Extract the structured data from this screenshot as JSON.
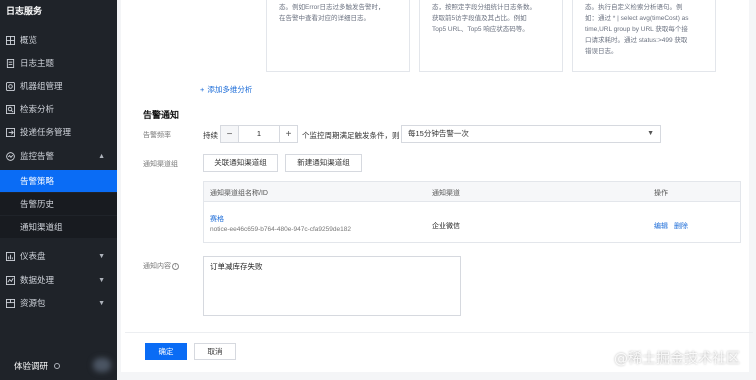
{
  "app": {
    "title": "日志服务"
  },
  "sidebar": {
    "items": [
      {
        "label": "概览",
        "icon": "grid-icon"
      },
      {
        "label": "日志主题",
        "icon": "document-icon"
      },
      {
        "label": "机器组管理",
        "icon": "server-icon"
      },
      {
        "label": "检索分析",
        "icon": "search-icon"
      },
      {
        "label": "投递任务管理",
        "icon": "export-icon"
      },
      {
        "label": "监控告警",
        "icon": "alarm-icon",
        "expanded": true
      },
      {
        "label": "告警策略",
        "sub": true,
        "active": true
      },
      {
        "label": "告警历史",
        "sub": true
      },
      {
        "label": "通知渠道组",
        "sub": true
      },
      {
        "label": "仪表盘",
        "icon": "dashboard-icon"
      },
      {
        "label": "数据处理",
        "icon": "data-icon"
      },
      {
        "label": "资源包",
        "icon": "package-icon"
      }
    ],
    "bottom_label": "体验调研"
  },
  "cards": [
    {
      "lines": [
        "态。例如Error日志过多触发告警时，",
        "在告警中查看对应的详细日志。"
      ]
    },
    {
      "lines": [
        "态，按照定字段分组统计日志条数。",
        "获取前5访字段值及其占比。例如",
        "Top5 URL、Top5 响应状态码等。"
      ]
    },
    {
      "lines": [
        "态。执行自定义检索分析语句。例",
        "如：通过 * | select avg(timeCost) as",
        "time,URL group by URL 获取每个接",
        "口请求耗时。通过 status:>499 获取",
        "错误日志。"
      ]
    }
  ],
  "add_analysis": "添加多维分析",
  "alarm_section": {
    "title": "告警通知",
    "frequency_label": "告警频率",
    "persist_text": "持续",
    "stepper_value": "1",
    "cycle_text": "个监控周期满足触发条件，则",
    "frequency_select": "每15分钟告警一次",
    "channel_label": "通知渠道组",
    "link_channel_button": "关联通知渠道组",
    "new_channel_button": "新建通知渠道组",
    "table": {
      "headers": [
        "通知渠道组名称/ID",
        "通知渠道",
        "操作"
      ],
      "rows": [
        {
          "name": "赛格",
          "id": "notice-ee46c659-b764-480e-947c-cfa9259de182",
          "channel": "企业微信",
          "actions": [
            "编辑",
            "删除"
          ]
        }
      ]
    },
    "content_label": "通知内容",
    "content_value": "订单减库存失败"
  },
  "footer": {
    "confirm": "确定",
    "cancel": "取消"
  },
  "watermark": "@稀土掘金技术社区",
  "colors": {
    "accent": "#0a6cf5",
    "sidebar_bg": "#1f2329",
    "link": "#1a6bd8"
  }
}
